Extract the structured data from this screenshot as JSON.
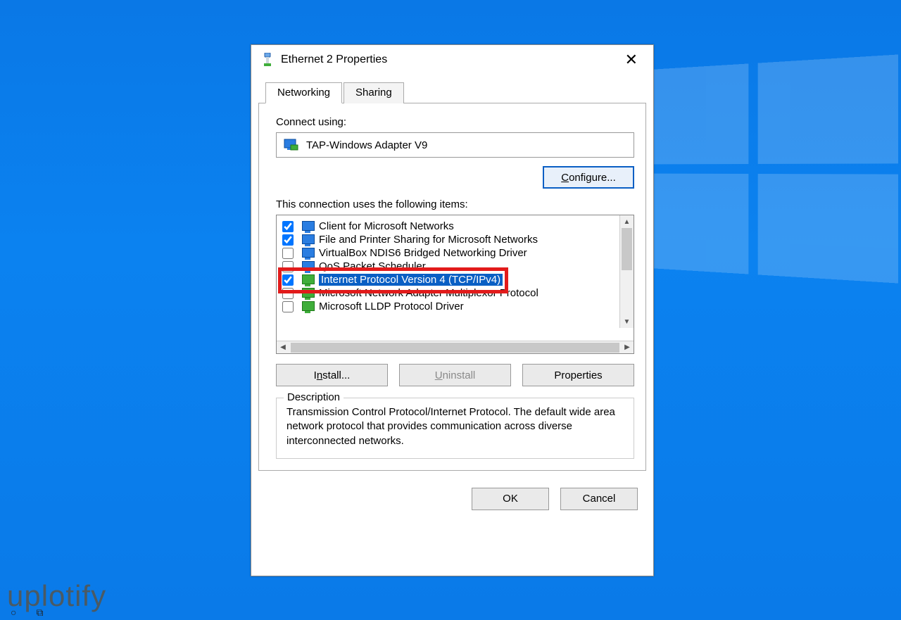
{
  "watermark": "uplotify",
  "dialog": {
    "title": "Ethernet 2 Properties",
    "tabs": {
      "networking": "Networking",
      "sharing": "Sharing"
    },
    "connect_label": "Connect using:",
    "adapter_name": "TAP-Windows Adapter V9",
    "configure_btn": "Configure...",
    "items_label": "This connection uses the following items:",
    "items": [
      {
        "checked": true,
        "label": "Client for Microsoft Networks",
        "icon": "monitor"
      },
      {
        "checked": true,
        "label": "File and Printer Sharing for Microsoft Networks",
        "icon": "monitor"
      },
      {
        "checked": false,
        "label": "VirtualBox NDIS6 Bridged Networking Driver",
        "icon": "monitor"
      },
      {
        "checked": false,
        "label": "QoS Packet Scheduler",
        "icon": "monitor"
      },
      {
        "checked": true,
        "label": "Internet Protocol Version 4 (TCP/IPv4)",
        "icon": "green",
        "selected": true
      },
      {
        "checked": false,
        "label": "Microsoft Network Adapter Multiplexor Protocol",
        "icon": "green"
      },
      {
        "checked": false,
        "label": "Microsoft LLDP Protocol Driver",
        "icon": "green"
      }
    ],
    "install_btn": "Install...",
    "uninstall_btn": "Uninstall",
    "properties_btn": "Properties",
    "description_label": "Description",
    "description_text": "Transmission Control Protocol/Internet Protocol. The default wide area network protocol that provides communication across diverse interconnected networks.",
    "ok_btn": "OK",
    "cancel_btn": "Cancel"
  }
}
